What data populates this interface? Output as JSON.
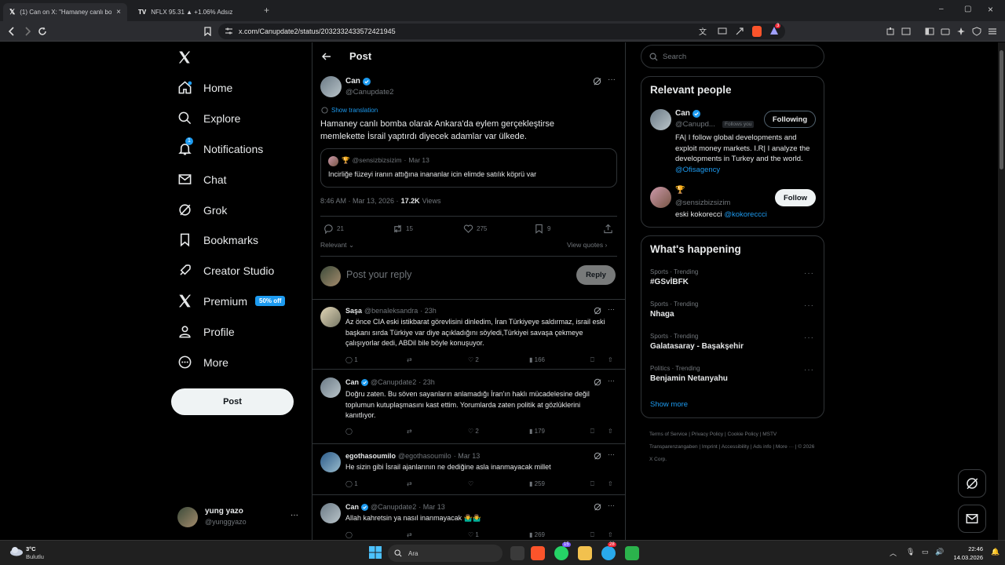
{
  "browser": {
    "tabs": [
      {
        "title": "(1) Can on X: \"Hamaney canlı bo",
        "close": "×"
      },
      {
        "title": "NFLX 95.31 ▲ +1.06% Adsız"
      }
    ],
    "new_tab": "+",
    "url": "x.com/Canupdate2/status/2032332433572421945",
    "window_controls": [
      "–",
      "▢",
      "×"
    ],
    "shield_badge": "3"
  },
  "sidebar": {
    "items": [
      {
        "label": "Home",
        "icon": "home-icon"
      },
      {
        "label": "Explore",
        "icon": "search-icon"
      },
      {
        "label": "Notifications",
        "icon": "bell-icon",
        "badge": "1"
      },
      {
        "label": "Chat",
        "icon": "mail-icon"
      },
      {
        "label": "Grok",
        "icon": "grok-icon"
      },
      {
        "label": "Bookmarks",
        "icon": "bookmark-icon"
      },
      {
        "label": "Creator Studio",
        "icon": "rocket-icon"
      },
      {
        "label": "Premium",
        "icon": "x-icon",
        "badge": "50% off"
      },
      {
        "label": "Profile",
        "icon": "person-icon"
      },
      {
        "label": "More",
        "icon": "more-circle-icon"
      }
    ],
    "post_button": "Post",
    "account": {
      "name": "yung yazo",
      "handle": "@yunggyazo",
      "more": "···"
    }
  },
  "post": {
    "header": "Post",
    "author": {
      "name": "Can",
      "handle": "@Canupdate2"
    },
    "show_translation": "Show translation",
    "text": "Hamaney canlı bomba olarak Ankara'da eylem gerçekleştirse memlekette İsrail yaptırdı diyecek adamlar var ülkede.",
    "quote": {
      "emoji": "🏆",
      "handle": "@sensizbizsizim",
      "sep": "·",
      "date": "Mar 13",
      "text": "Incirliğe füzeyi iranın attığına inananlar icin elimde satılık köprü var"
    },
    "meta": {
      "time": "8:46 AM · Mar 13, 2026 ·",
      "views_count": "17.2K",
      "views_label": "Views"
    },
    "stats": {
      "replies": "21",
      "reposts": "15",
      "likes": "275",
      "bookmarks": "9"
    },
    "sort_label": "Relevant",
    "view_quotes": "View quotes",
    "reply_placeholder": "Post your reply",
    "reply_button": "Reply"
  },
  "replies": [
    {
      "name": "Saşa",
      "handle": "@benaleksandra",
      "time": "· 23h",
      "text": "Az önce CIA eski istikbarat görevlisini dinledim, İran Türkiyeye saldırmaz, israil eski başkanı sırda Türkiye var diye açıkladığını söyledi,Türkiyei savaşa çekmeye çalışıyorlar dedi, ABDil bile böyle konuşuyor.",
      "replies": "1",
      "reposts": "",
      "likes": "2",
      "views": "166"
    },
    {
      "name": "Can",
      "handle": "@Canupdate2",
      "time": "· 23h",
      "text": "Doğru zaten. Bu söven sayanların anlamadığı İran'ın haklı mücadelesine değil toplumun kutuplaşmasını kast ettim. Yorumlarda zaten politik at gözlüklerini kanıtlıyor.",
      "replies": "",
      "reposts": "",
      "likes": "2",
      "views": "179"
    },
    {
      "name": "egothasoumilo",
      "handle": "@egothasoumilo",
      "time": "· Mar 13",
      "text": "He sizin gibi İsrail ajanlarının ne dediğine asla inanmayacak millet",
      "replies": "1",
      "reposts": "",
      "likes": "",
      "views": "259"
    },
    {
      "name": "Can",
      "handle": "@Canupdate2",
      "time": "· Mar 13",
      "text": "Allah kahretsin ya nasıl inanmayacak 🤷‍♂️🤷‍♂️",
      "replies": "",
      "reposts": "",
      "likes": "1",
      "views": "269"
    }
  ],
  "search": {
    "placeholder": "Search"
  },
  "relevant_people": {
    "title": "Relevant people",
    "people": [
      {
        "name": "Can",
        "handle": "@Canupd...",
        "follows_you": "Follows you",
        "button": "Following",
        "bio": "FA| I follow global developments and exploit money markets. I.R| I analyze the developments in Turkey and the world.",
        "bio_link": "@Ofisagency"
      },
      {
        "name": "🏆",
        "handle": "@sensizbizsizim",
        "button": "Follow",
        "bio": "eski kokorecci",
        "bio_link": "@kokoreccci"
      }
    ]
  },
  "happening": {
    "title": "What's happening",
    "trends": [
      {
        "context": "Sports · Trending",
        "topic": "#GSvİBFK"
      },
      {
        "context": "Sports · Trending",
        "topic": "Nhaga"
      },
      {
        "context": "Sports · Trending",
        "topic": "Galatasaray - Başakşehir"
      },
      {
        "context": "Politics · Trending",
        "topic": "Benjamin Netanyahu"
      }
    ],
    "show_more": "Show more"
  },
  "footer": {
    "links": [
      "Terms of Service",
      "Privacy Policy",
      "Cookie Policy",
      "MSTV Transparenzangaben",
      "Imprint",
      "Accessibility",
      "Ads info",
      "More ···"
    ],
    "copyright": "© 2026 X Corp."
  },
  "taskbar": {
    "weather_temp": "3°C",
    "weather_desc": "Bulutlu",
    "search": "Ara",
    "time": "22:46",
    "date": "14.03.2026",
    "whatsapp_badge": "15",
    "telegram_badge": "28"
  },
  "colors": {
    "accent": "#1d9bf0",
    "background": "#000000",
    "border": "#2f3336",
    "muted": "#71767b"
  }
}
